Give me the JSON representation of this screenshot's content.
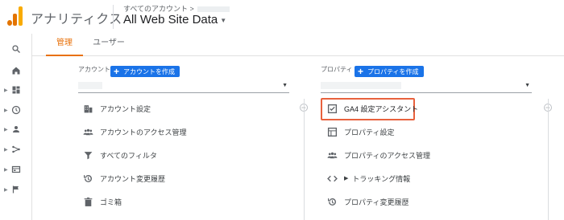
{
  "header": {
    "app_name": "アナリティクス",
    "breadcrumb": "すべてのアカウント >",
    "property_name": "All Web Site Data"
  },
  "tabs": [
    {
      "label": "管理",
      "active": true
    },
    {
      "label": "ユーザー",
      "active": false
    }
  ],
  "account": {
    "heading": "アカウント",
    "create_button": "アカウントを作成",
    "items": [
      {
        "label": "アカウント設定",
        "icon": "building-icon"
      },
      {
        "label": "アカウントのアクセス管理",
        "icon": "people-icon"
      },
      {
        "label": "すべてのフィルタ",
        "icon": "filter-icon"
      },
      {
        "label": "アカウント変更履歴",
        "icon": "history-icon"
      },
      {
        "label": "ゴミ箱",
        "icon": "trash-icon"
      }
    ]
  },
  "property": {
    "heading": "プロパティ",
    "create_button": "プロパティを作成",
    "items": [
      {
        "label": "GA4 設定アシスタント",
        "icon": "checkbox-icon",
        "highlighted": true
      },
      {
        "label": "プロパティ設定",
        "icon": "layout-icon"
      },
      {
        "label": "プロパティのアクセス管理",
        "icon": "people-icon"
      },
      {
        "label": "トラッキング情報",
        "icon": "code-icon"
      },
      {
        "label": "プロパティ変更履歴",
        "icon": "history-icon"
      }
    ]
  },
  "sidebar_icons": [
    "search-icon",
    "home-icon",
    "dashboard-icon",
    "clock-icon",
    "person-icon",
    "acquisition-icon",
    "behavior-icon",
    "flag-icon"
  ],
  "colors": {
    "accent": "#e8710a",
    "button": "#1a73e8",
    "highlight": "#e8613d"
  }
}
